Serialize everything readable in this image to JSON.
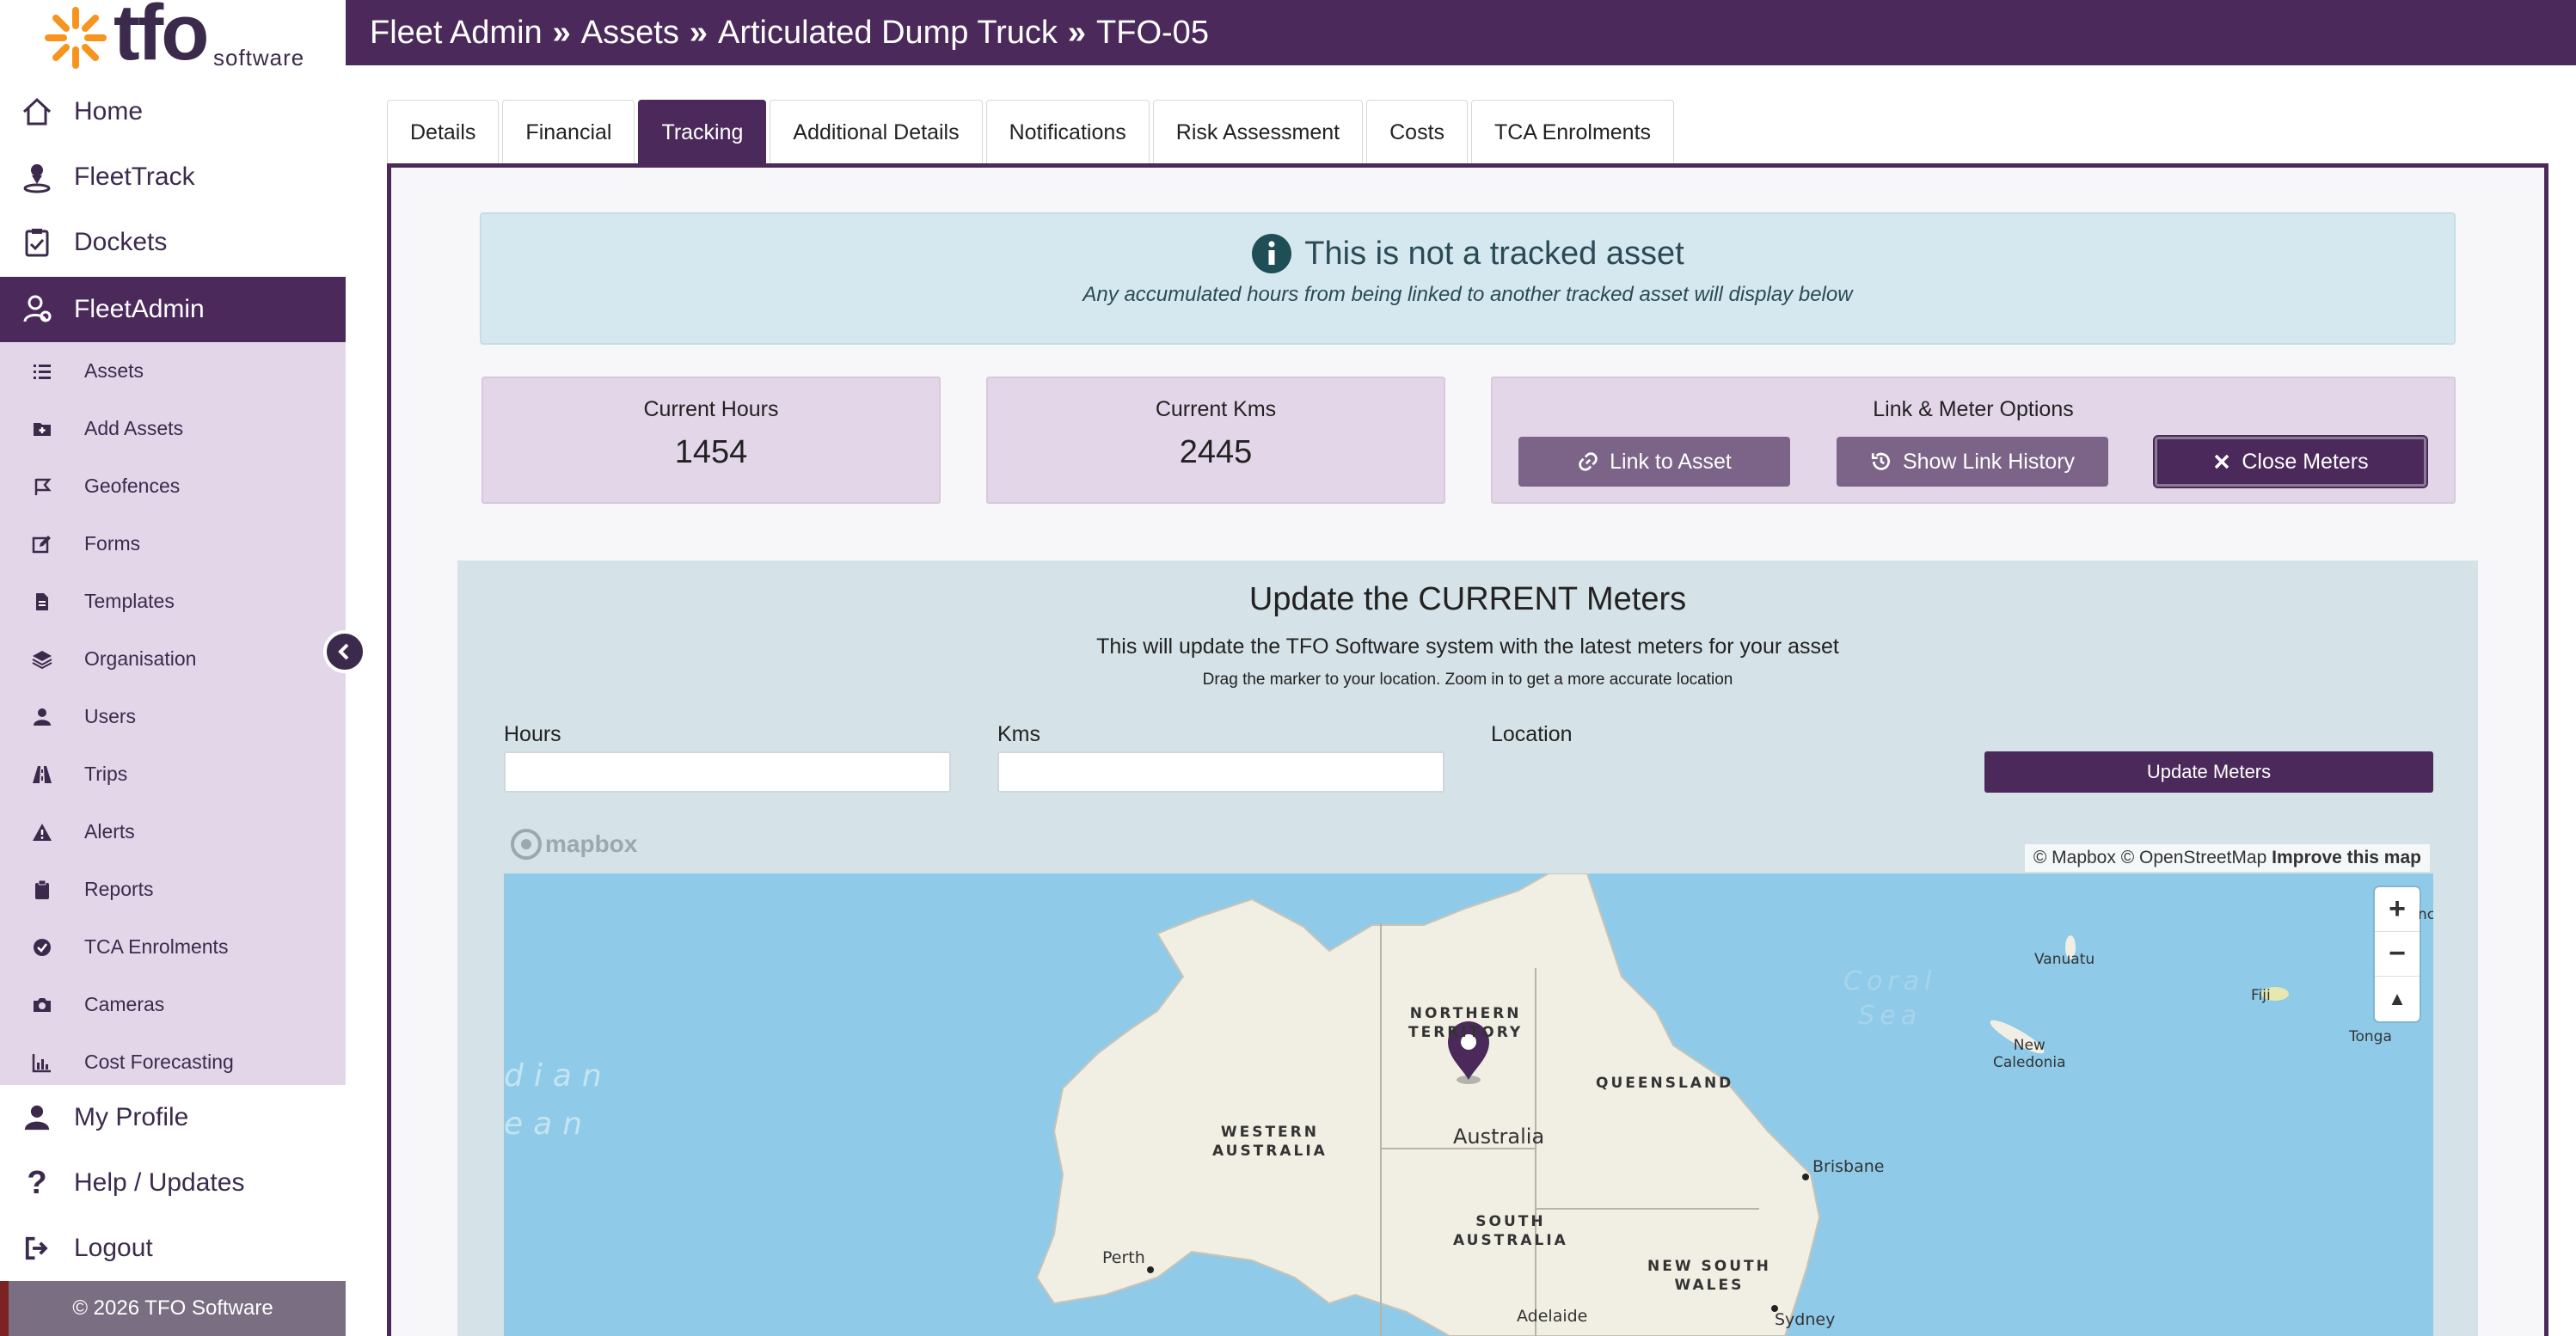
{
  "logo": {
    "text": "tfo",
    "subtext": "software"
  },
  "header": {
    "crumbs": [
      "Fleet Admin",
      "Assets",
      "Articulated Dump Truck",
      "TFO-05"
    ],
    "separator": "»"
  },
  "sidebar": {
    "main": [
      {
        "label": "Home",
        "icon": "home-icon"
      },
      {
        "label": "FleetTrack",
        "icon": "location-person-icon"
      },
      {
        "label": "Dockets",
        "icon": "clipboard-check-icon"
      },
      {
        "label": "FleetAdmin",
        "icon": "users-gear-icon",
        "active": true
      }
    ],
    "submenu": [
      {
        "label": "Assets",
        "icon": "list-icon"
      },
      {
        "label": "Add Assets",
        "icon": "folder-plus-icon"
      },
      {
        "label": "Geofences",
        "icon": "flag-icon"
      },
      {
        "label": "Forms",
        "icon": "edit-icon"
      },
      {
        "label": "Templates",
        "icon": "file-icon"
      },
      {
        "label": "Organisation",
        "icon": "layers-icon"
      },
      {
        "label": "Users",
        "icon": "user-icon"
      },
      {
        "label": "Trips",
        "icon": "road-icon"
      },
      {
        "label": "Alerts",
        "icon": "warning-icon"
      },
      {
        "label": "Reports",
        "icon": "clipboard-icon"
      },
      {
        "label": "TCA Enrolments",
        "icon": "check-circle-icon"
      },
      {
        "label": "Cameras",
        "icon": "camera-icon"
      },
      {
        "label": "Cost Forecasting",
        "icon": "chart-icon"
      }
    ],
    "bottom": [
      {
        "label": "My Profile",
        "icon": "user-icon"
      },
      {
        "label": "Help / Updates",
        "icon": "question-icon"
      },
      {
        "label": "Logout",
        "icon": "logout-icon"
      }
    ],
    "footer": "© 2026 TFO Software"
  },
  "tabs": [
    {
      "label": "Details"
    },
    {
      "label": "Financial"
    },
    {
      "label": "Tracking",
      "active": true
    },
    {
      "label": "Additional Details"
    },
    {
      "label": "Notifications"
    },
    {
      "label": "Risk Assessment"
    },
    {
      "label": "Costs"
    },
    {
      "label": "TCA Enrolments"
    }
  ],
  "alert": {
    "title": "This is not a tracked asset",
    "subtitle": "Any accumulated hours from being linked to another tracked asset will display below"
  },
  "stats": {
    "hours": {
      "label": "Current Hours",
      "value": "1454"
    },
    "kms": {
      "label": "Current Kms",
      "value": "2445"
    }
  },
  "link_options": {
    "label": "Link & Meter Options",
    "link_button": "Link to Asset",
    "history_button": "Show Link History",
    "close_button": "Close Meters"
  },
  "update": {
    "title": "Update the CURRENT Meters",
    "description": "This will update the TFO Software system with the latest meters for your asset",
    "hint": "Drag the marker to your location. Zoom in to get a more accurate location",
    "hours_label": "Hours",
    "hours_value": "",
    "kms_label": "Kms",
    "kms_value": "",
    "location_label": "Location",
    "submit_label": "Update Meters"
  },
  "map": {
    "brand": "mapbox",
    "attribution": "© Mapbox © OpenStreetMap",
    "improve": "Improve this map",
    "labels": {
      "nt": [
        "NORTHERN",
        "TERRITORY"
      ],
      "qld": "QUEENSLAND",
      "wa": [
        "WESTERN",
        "AUSTRALIA"
      ],
      "sa": [
        "SOUTH",
        "AUSTRALIA"
      ],
      "nsw": [
        "NEW SOUTH",
        "WALES"
      ],
      "country": "Australia",
      "coral": [
        "Coral",
        "Sea"
      ],
      "indian": [
        "dian",
        "ean"
      ],
      "vanuatu": "Vanuatu",
      "fiji": "Fiji",
      "tonga": "Tonga",
      "caledonia": [
        "New",
        "Caledonia"
      ],
      "brisbane": "Brisbane",
      "perth": "Perth",
      "sydney": "Sydney",
      "adelaide": "Adelaide",
      "edge": "nc"
    }
  },
  "colors": {
    "brand": "#4b2a5b",
    "submenu": "#e4d6e9",
    "accent": "#f7941d"
  }
}
